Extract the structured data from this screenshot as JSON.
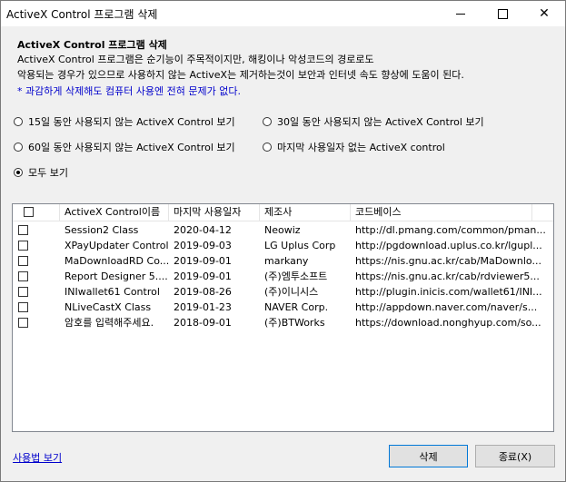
{
  "window": {
    "title": "ActiveX Control 프로그램 삭제"
  },
  "header": {
    "title": "ActiveX Control 프로그램 삭제",
    "desc_line1": "ActiveX Control 프로그램은 순기능이 주목적이지만, 해킹이나 악성코드의 경로로도",
    "desc_line2": "악용되는 경우가 있으므로 사용하지 않는 ActiveX는 제거하는것이 보안과 인터넷 속도 향상에 도움이 된다.",
    "note": "* 과감하게 삭제해도 컴퓨터 사용엔 전혀 문제가 없다."
  },
  "filters": {
    "opt_15": "15일 동안 사용되지 않는 ActiveX Control 보기",
    "opt_30": "30일 동안 사용되지 않는 ActiveX Control 보기",
    "opt_60": "60일 동안 사용되지 않는 ActiveX Control 보기",
    "opt_nodate": "마지막 사용일자 없는 ActiveX control",
    "opt_all": "모두 보기",
    "selected": "opt_all"
  },
  "list": {
    "columns": [
      "ActiveX Control이름",
      "마지막 사용일자",
      "제조사",
      "코드베이스"
    ],
    "rows": [
      {
        "name": "Session2 Class",
        "date": "2020-04-12",
        "vendor": "Neowiz",
        "codebase": "http://dl.pmang.com/common/pman..."
      },
      {
        "name": "XPayUpdater Control",
        "date": "2019-09-03",
        "vendor": "LG Uplus Corp",
        "codebase": "http://pgdownload.uplus.co.kr/lgupl..."
      },
      {
        "name": "MaDownloadRD Co...",
        "date": "2019-09-01",
        "vendor": "markany",
        "codebase": "https://nis.gnu.ac.kr/cab/MaDownlo..."
      },
      {
        "name": "Report Designer 5....",
        "date": "2019-09-01",
        "vendor": "(주)엠투소프트",
        "codebase": "https://nis.gnu.ac.kr/cab/rdviewer5..."
      },
      {
        "name": "INIwallet61 Control",
        "date": "2019-08-26",
        "vendor": "(주)이니시스",
        "codebase": "http://plugin.inicis.com/wallet61/INI..."
      },
      {
        "name": "NLiveCastX Class",
        "date": "2019-01-23",
        "vendor": "NAVER Corp.",
        "codebase": "http://appdown.naver.com/naver/s..."
      },
      {
        "name": "암호를 입력해주세요.",
        "date": "2018-09-01",
        "vendor": "(주)BTWorks",
        "codebase": "https://download.nonghyup.com/so..."
      }
    ]
  },
  "footer": {
    "help_link": "사용법 보기",
    "delete_label": "삭제",
    "close_label": "종료(X)"
  }
}
